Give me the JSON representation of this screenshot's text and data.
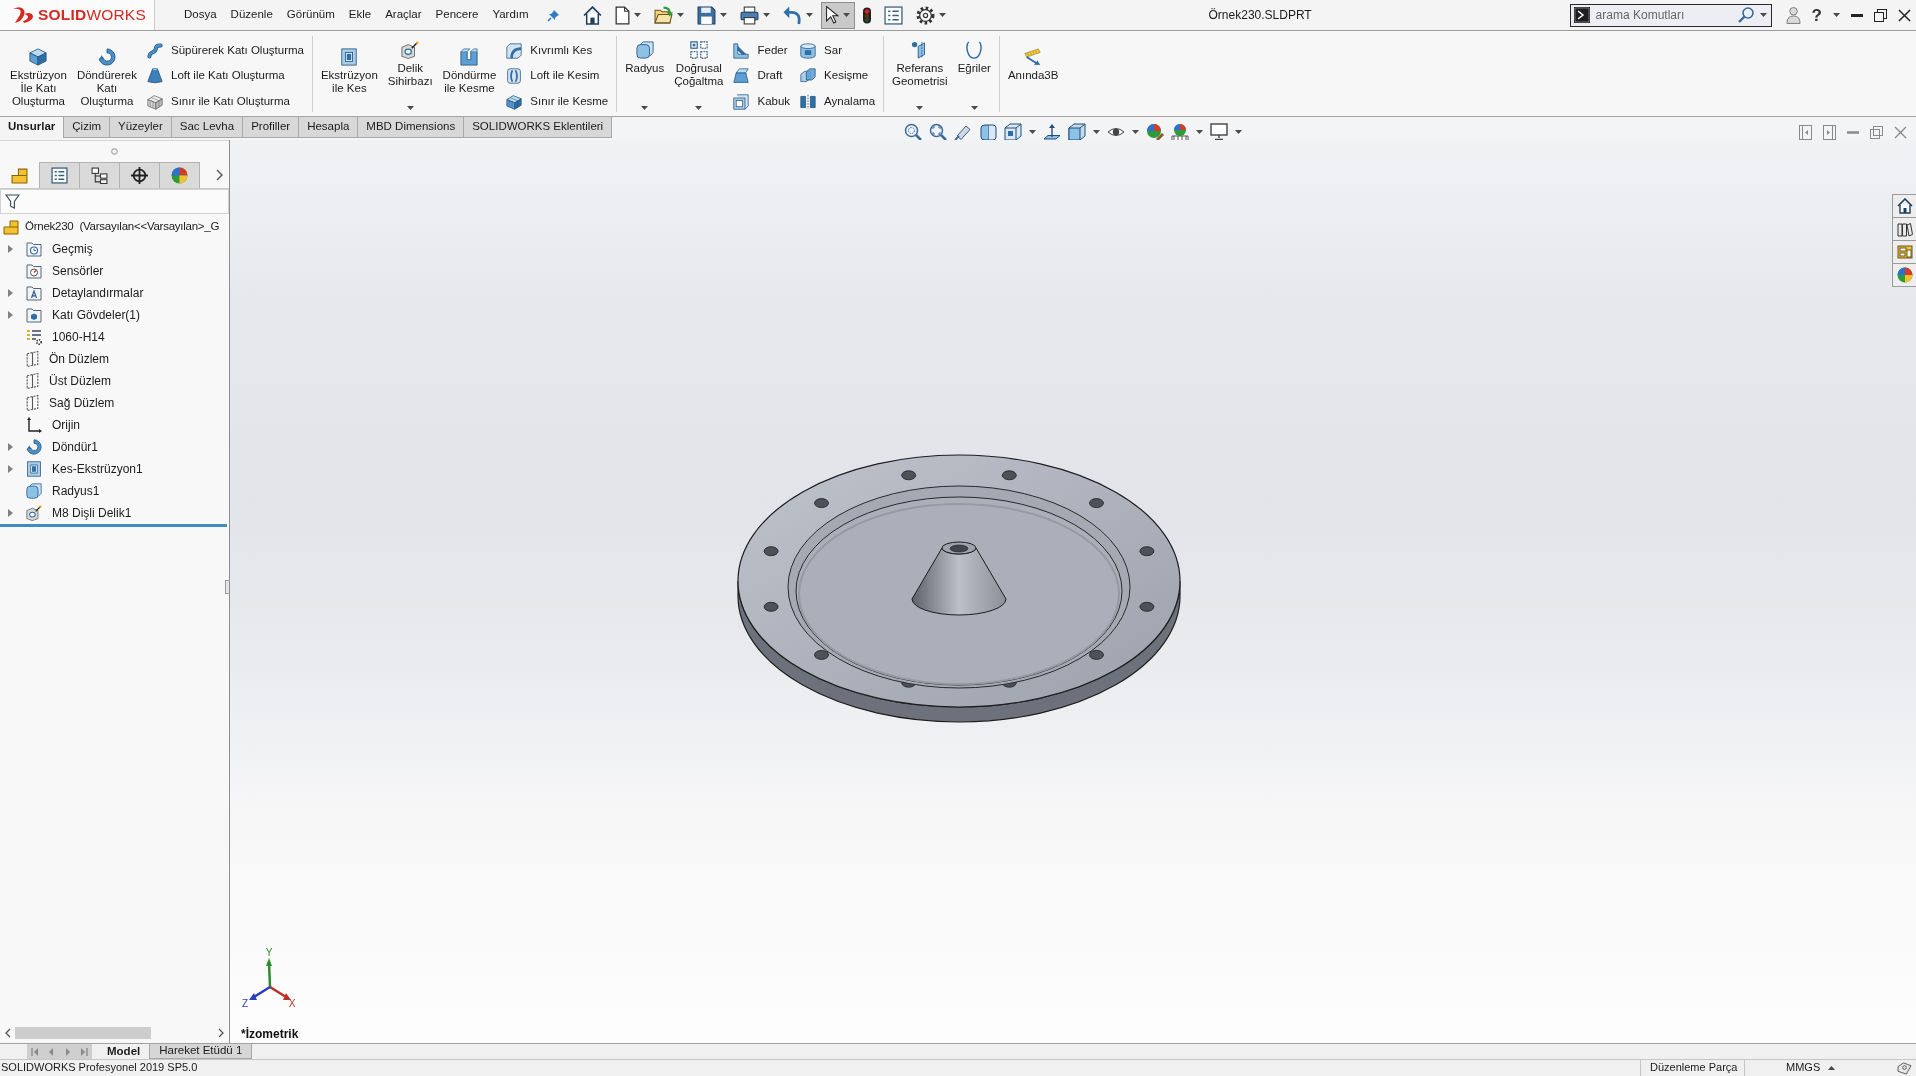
{
  "app": {
    "logo": "**SOLID**WORKS"
  },
  "menu": [
    "Dosya",
    "Düzenle",
    "Görünüm",
    "Ekle",
    "Araçlar",
    "Pencere",
    "Yardım"
  ],
  "quick_access": [
    {
      "kind": "home",
      "dropdown": false,
      "selected": false
    },
    {
      "kind": "new",
      "dropdown": true,
      "selected": false
    },
    {
      "kind": "open",
      "dropdown": true,
      "selected": false
    },
    {
      "kind": "save",
      "dropdown": true,
      "selected": false
    },
    {
      "kind": "print",
      "dropdown": true,
      "selected": false
    },
    {
      "kind": "undo",
      "dropdown": true,
      "selected": false
    },
    {
      "kind": "select",
      "dropdown": true,
      "selected": true
    },
    {
      "kind": "rebuild",
      "dropdown": false,
      "selected": false
    },
    {
      "kind": "properties",
      "dropdown": false,
      "selected": false
    },
    {
      "kind": "options",
      "dropdown": true,
      "selected": false
    }
  ],
  "window": {
    "title": "Örnek230.SLDPRT",
    "help_button": "?"
  },
  "search": {
    "placeholder": "arama Komutları"
  },
  "ribbon": {
    "groups": [
      {
        "items": [
          {
            "kind": "large",
            "label": "Ekstrüzyon\nİle Katı\nOluşturma",
            "dropdown": false
          },
          {
            "kind": "large",
            "label": "Döndürerek\nKatı\nOluşturma",
            "dropdown": false
          },
          {
            "kind": "stack",
            "items": [
              "Süpürerek Katı Oluşturma",
              "Loft ile Katı Oluşturma",
              "Sınır ile Katı Oluşturma"
            ]
          }
        ]
      },
      {
        "items": [
          {
            "kind": "large",
            "label": "Ekstrüzyon\nile Kes",
            "dropdown": false
          },
          {
            "kind": "large",
            "label": "Delik\nSihirbazı",
            "dropdown": true
          },
          {
            "kind": "large",
            "label": "Döndürme\nile Kesme",
            "dropdown": false
          },
          {
            "kind": "stack",
            "items": [
              "Kıvrımlı Kes",
              "Loft ile Kesim",
              "Sınır ile Kesme"
            ]
          }
        ]
      },
      {
        "items": [
          {
            "kind": "large",
            "label": "Radyus",
            "dropdown": true
          },
          {
            "kind": "large",
            "label": "Doğrusal\nÇoğaltma",
            "dropdown": true
          },
          {
            "kind": "stack",
            "items": [
              "Feder",
              "Draft",
              "Kabuk"
            ]
          },
          {
            "kind": "stack",
            "items": [
              "Sar",
              "Kesişme",
              "Aynalama"
            ]
          }
        ]
      },
      {
        "items": [
          {
            "kind": "large",
            "label": "Referans\nGeometrisi",
            "dropdown": true
          },
          {
            "kind": "large",
            "label": "Eğriler",
            "dropdown": true
          }
        ]
      },
      {
        "items": [
          {
            "kind": "large",
            "label": "Anında3B",
            "dropdown": false
          }
        ]
      }
    ]
  },
  "command_tabs": [
    {
      "label": "Unsurlar",
      "selected": true
    },
    {
      "label": "Çizim",
      "selected": false
    },
    {
      "label": "Yüzeyler",
      "selected": false
    },
    {
      "label": "Sac Levha",
      "selected": false
    },
    {
      "label": "Profiller",
      "selected": false
    },
    {
      "label": "Hesapla",
      "selected": false
    },
    {
      "label": "MBD Dimensions",
      "selected": false
    },
    {
      "label": "SOLIDWORKS Eklentileri",
      "selected": false
    }
  ],
  "feature_manager": {
    "panel_tabs": [
      {
        "kind": "feature_manager",
        "selected": true
      },
      {
        "kind": "property_manager",
        "selected": false
      },
      {
        "kind": "configuration_manager",
        "selected": false
      },
      {
        "kind": "dimxpert",
        "selected": false
      },
      {
        "kind": "display_manager",
        "selected": false
      }
    ],
    "tree": {
      "root": "Örnek230  (Varsayılan<<Varsayılan>_G",
      "items": [
        {
          "kind": "history",
          "label": "Geçmiş",
          "expandable": true
        },
        {
          "kind": "sensors",
          "label": "Sensörler",
          "expandable": false
        },
        {
          "kind": "annotations",
          "label": "Detaylandırmalar",
          "expandable": true
        },
        {
          "kind": "bodies",
          "label": "Katı Gövdeler(1)",
          "expandable": true
        },
        {
          "kind": "material",
          "label": "1060-H14",
          "expandable": false
        },
        {
          "kind": "plane",
          "label": "Ön Düzlem",
          "expandable": false
        },
        {
          "kind": "plane",
          "label": "Üst Düzlem",
          "expandable": false
        },
        {
          "kind": "plane",
          "label": "Sağ Düzlem",
          "expandable": false
        },
        {
          "kind": "origin",
          "label": "Orijin",
          "expandable": false
        },
        {
          "kind": "revolve",
          "label": "Döndür1",
          "expandable": true
        },
        {
          "kind": "cut",
          "label": "Kes-Ekstrüzyon1",
          "expandable": true
        },
        {
          "kind": "fillet",
          "label": "Radyus1",
          "expandable": false
        },
        {
          "kind": "hole",
          "label": "M8 Dişli Delik1",
          "expandable": true
        }
      ]
    }
  },
  "viewport": {
    "triad": {
      "x": "X",
      "y": "Y",
      "z": "Z"
    },
    "view_name": "*İzometrik"
  },
  "bottom_tabs": [
    {
      "label": "Model",
      "selected": true
    },
    {
      "label": "Hareket Etüdü 1",
      "selected": false
    }
  ],
  "status_bar": {
    "product": "SOLIDWORKS Profesyonel 2019 SP5.0",
    "mode": "Düzenleme Parça",
    "units": "MMGS"
  }
}
